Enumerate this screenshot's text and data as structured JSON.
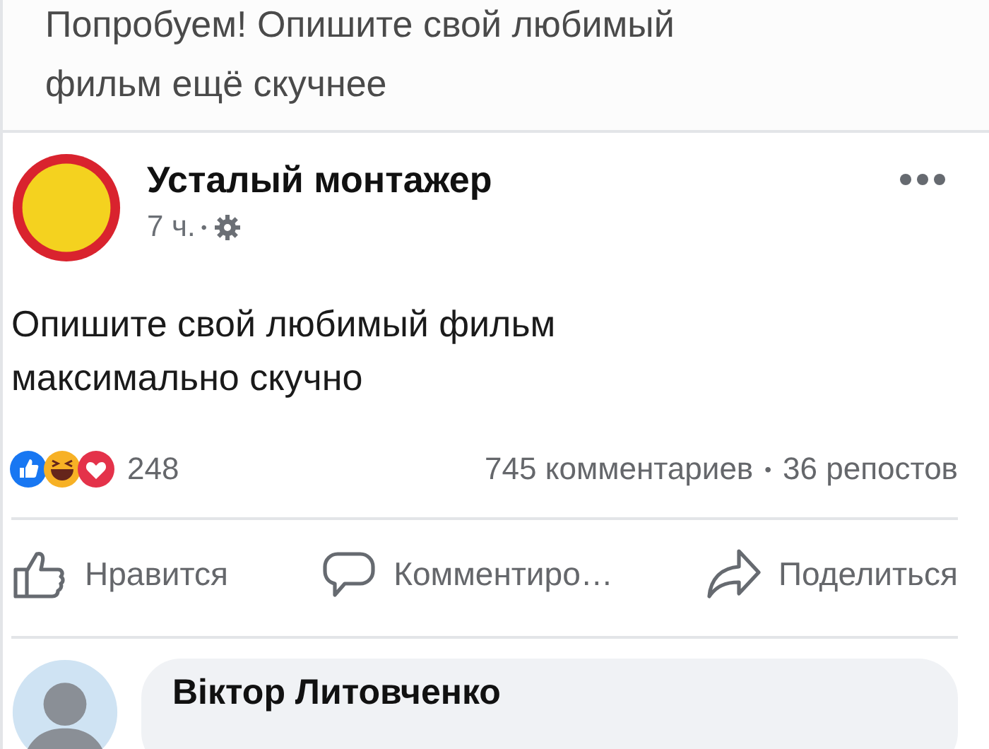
{
  "previous_post": {
    "text_lines": [
      "Попробуем! Опишите свой любимый",
      "фильм ещё скучнее"
    ]
  },
  "post": {
    "author": "Усталый монтажер",
    "time": "7 ч.",
    "separator": "•",
    "text_lines": [
      "Опишите свой любимый фильм",
      "максимально скучно"
    ],
    "reactions_count": "248",
    "comments": "745 комментариев",
    "stats_separator": "•",
    "shares": "36 репостов",
    "actions": [
      {
        "kind": "like",
        "label": "Нравится"
      },
      {
        "kind": "comment",
        "label": "Комментиро…"
      },
      {
        "kind": "share",
        "label": "Поделиться"
      }
    ]
  },
  "comment": {
    "author": "Віктор Литовченко"
  }
}
